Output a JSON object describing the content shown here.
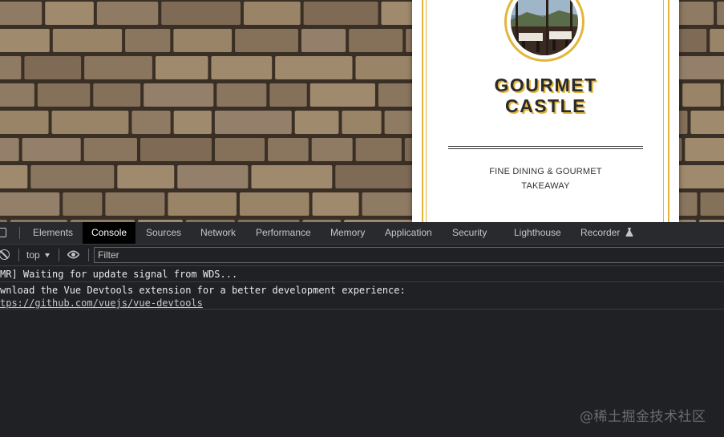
{
  "page": {
    "brand_line1": "GOURMET",
    "brand_line2": "CASTLE",
    "tagline_line1": "FINE DINING & GOURMET",
    "tagline_line2": "TAKEAWAY",
    "accent_color": "#e3b53a",
    "avatar_icon": "restaurant-photo"
  },
  "devtools": {
    "tabs": [
      {
        "label": "Elements"
      },
      {
        "label": "Console"
      },
      {
        "label": "Sources"
      },
      {
        "label": "Network"
      },
      {
        "label": "Performance"
      },
      {
        "label": "Memory"
      },
      {
        "label": "Application"
      },
      {
        "label": "Security"
      },
      {
        "label": "Lighthouse"
      },
      {
        "label": "Recorder"
      }
    ],
    "active_tab": "Console",
    "context": "top",
    "filter_placeholder": "Filter",
    "messages": [
      {
        "text": "MR] Waiting for update signal from WDS..."
      },
      {
        "text": "wnload the Vue Devtools extension for a better development experience:",
        "link": "tps://github.com/vuejs/vue-devtools"
      }
    ]
  },
  "watermark": "@稀土掘金技术社区"
}
